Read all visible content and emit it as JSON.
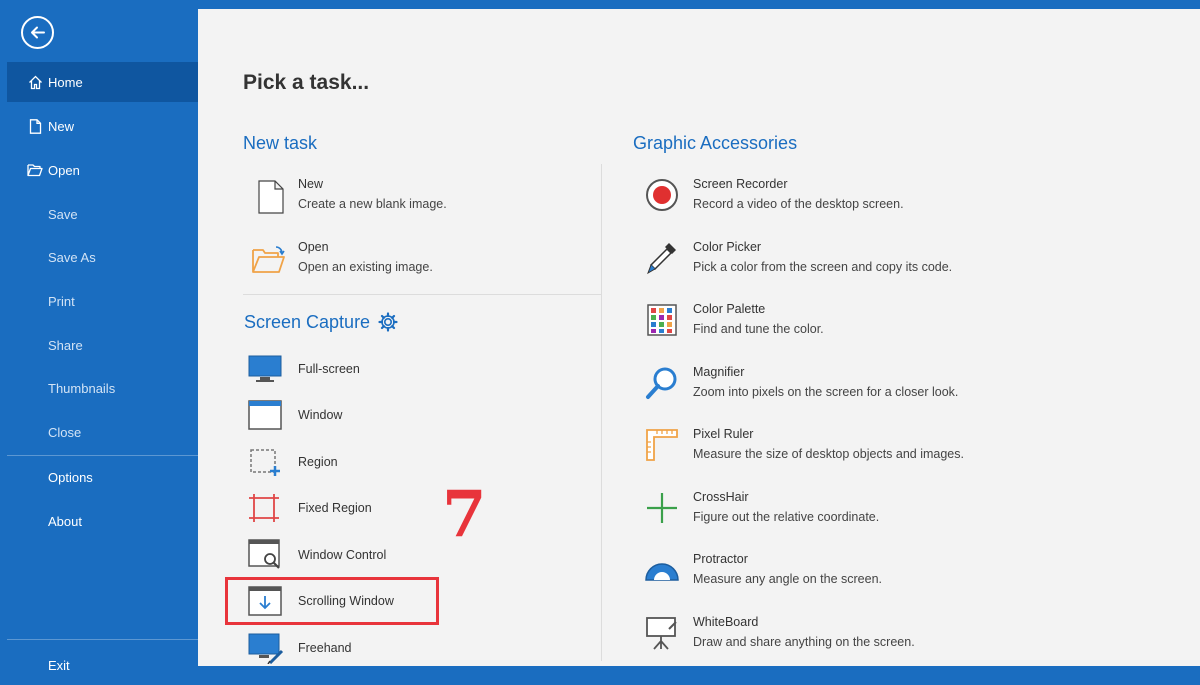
{
  "sidebar": {
    "items": [
      {
        "label": "Home",
        "icon": "home-icon"
      },
      {
        "label": "New",
        "icon": "new-file-icon"
      },
      {
        "label": "Open",
        "icon": "folder-open-icon"
      },
      {
        "label": "Save"
      },
      {
        "label": "Save As"
      },
      {
        "label": "Print"
      },
      {
        "label": "Share"
      },
      {
        "label": "Thumbnails"
      },
      {
        "label": "Close"
      },
      {
        "label": "Options"
      },
      {
        "label": "About"
      },
      {
        "label": "Exit"
      }
    ]
  },
  "main": {
    "title": "Pick a task...",
    "new_task": {
      "title": "New task",
      "items": [
        {
          "name": "New",
          "desc": "Create a new blank image.",
          "icon": "blank-page-icon"
        },
        {
          "name": "Open",
          "desc": "Open an existing image.",
          "icon": "folder-open-icon"
        }
      ]
    },
    "screen_capture": {
      "title": "Screen Capture",
      "settings_icon": "gear-icon",
      "items": [
        {
          "label": "Full-screen",
          "icon": "monitor-icon"
        },
        {
          "label": "Window",
          "icon": "window-icon"
        },
        {
          "label": "Region",
          "icon": "region-icon"
        },
        {
          "label": "Fixed Region",
          "icon": "fixed-region-icon"
        },
        {
          "label": "Window Control",
          "icon": "window-control-icon"
        },
        {
          "label": "Scrolling Window",
          "icon": "scrolling-window-icon"
        },
        {
          "label": "Freehand",
          "icon": "freehand-icon"
        }
      ]
    },
    "graphic_accessories": {
      "title": "Graphic Accessories",
      "items": [
        {
          "name": "Screen Recorder",
          "desc": "Record a video of the desktop screen.",
          "icon": "record-icon"
        },
        {
          "name": "Color Picker",
          "desc": "Pick a color from the screen and copy its code.",
          "icon": "eyedropper-icon"
        },
        {
          "name": "Color Palette",
          "desc": "Find and tune the color.",
          "icon": "palette-icon"
        },
        {
          "name": "Magnifier",
          "desc": "Zoom into pixels on the screen for a closer look.",
          "icon": "magnifier-icon"
        },
        {
          "name": "Pixel Ruler",
          "desc": "Measure the size of desktop objects and images.",
          "icon": "ruler-icon"
        },
        {
          "name": "CrossHair",
          "desc": "Figure out the relative coordinate.",
          "icon": "crosshair-icon"
        },
        {
          "name": "Protractor",
          "desc": "Measure any angle on the screen.",
          "icon": "protractor-icon"
        },
        {
          "name": "WhiteBoard",
          "desc": "Draw and share anything on the screen.",
          "icon": "whiteboard-icon"
        }
      ]
    }
  },
  "annotation": {
    "step_number": "7"
  },
  "colors": {
    "accent": "#1a6dc0",
    "highlight": "#e8343b",
    "panel": "#f3f3f3"
  }
}
